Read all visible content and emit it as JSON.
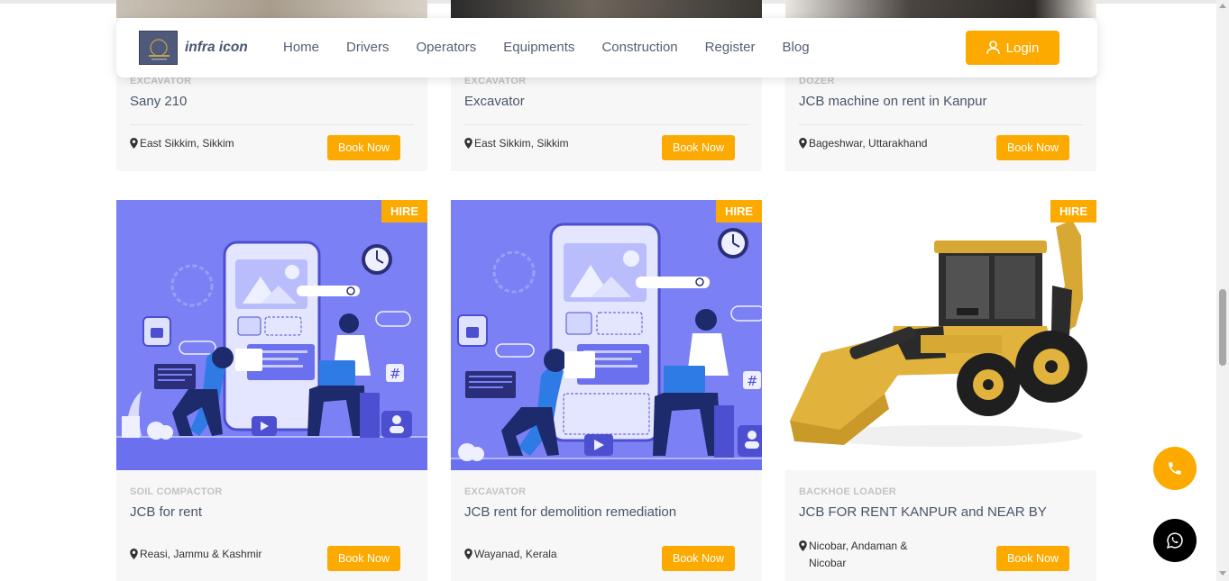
{
  "nav": {
    "brand": "infra icon",
    "menu": [
      "Home",
      "Drivers",
      "Operators",
      "Equipments",
      "Construction",
      "Register",
      "Blog"
    ],
    "login_label": "Login"
  },
  "colors": {
    "accent": "#fdaa00",
    "illustration_bg": "#7b81f5",
    "whatsapp_bg": "#000000"
  },
  "cards_top": [
    {
      "category": "EXCAVATOR",
      "title": "Sany 210",
      "location": "East Sikkim, Sikkim",
      "button": "Book Now"
    },
    {
      "category": "EXCAVATOR",
      "title": "Excavator",
      "location": "East Sikkim, Sikkim",
      "button": "Book Now"
    },
    {
      "category": "DOZER",
      "title": "JCB machine on rent in Kanpur",
      "location": "Bageshwar, Uttarakhand",
      "button": "Book Now"
    }
  ],
  "cards_bottom": [
    {
      "badge": "HIRE",
      "category": "SOIL COMPACTOR",
      "title": "JCB for rent",
      "location": "Reasi, Jammu & Kashmir",
      "button": "Book Now",
      "image": "illustration"
    },
    {
      "badge": "HIRE",
      "category": "EXCAVATOR",
      "title": "JCB rent for demolition remediation",
      "location": "Wayanad, Kerala",
      "button": "Book Now",
      "image": "illustration"
    },
    {
      "badge": "HIRE",
      "category": "BACKHOE LOADER",
      "title": "JCB FOR RENT KANPUR and NEAR BY",
      "location": "Nicobar, Andaman & Nicobar",
      "button": "Book Now",
      "image": "backhoe-loader"
    }
  ],
  "icons": {
    "phone": "phone-icon",
    "whatsapp": "whatsapp-icon",
    "user": "user-icon",
    "pin": "map-pin-icon"
  }
}
